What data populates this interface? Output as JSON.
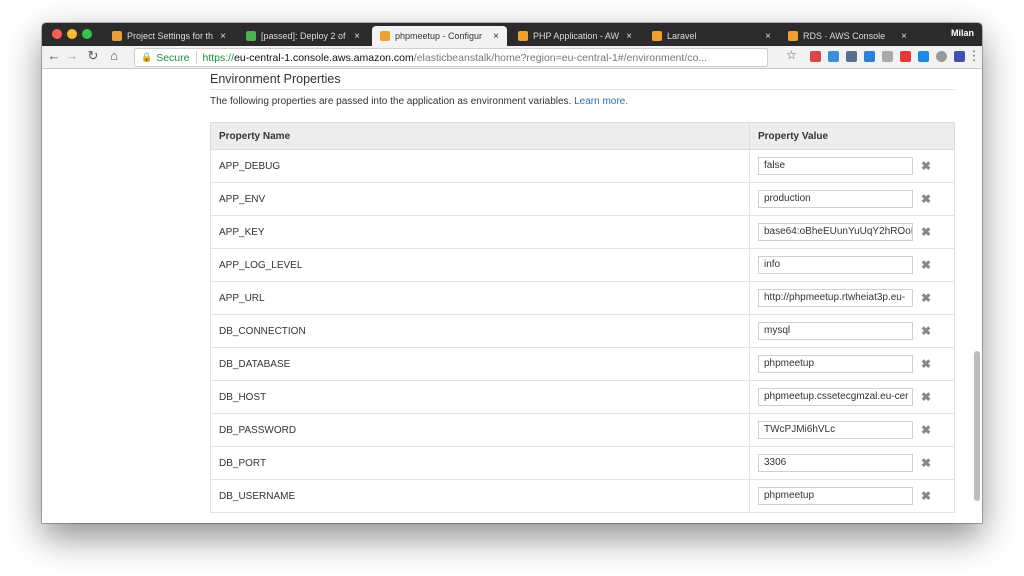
{
  "browser": {
    "tabs": [
      {
        "title": "Project Settings for th",
        "icon_color": "#e8a13a",
        "active": false
      },
      {
        "title": "[passed]: Deploy 2 of",
        "icon_color": "#4caf50",
        "active": false
      },
      {
        "title": "phpmeetup - Configur",
        "icon_color": "#f0a030",
        "active": true
      },
      {
        "title": "PHP Application - AW",
        "icon_color": "#f0a030",
        "active": false
      },
      {
        "title": "Laravel",
        "icon_color": "#f0a030",
        "active": false
      },
      {
        "title": "RDS · AWS Console",
        "icon_color": "#f0a030",
        "active": false
      }
    ],
    "profile_name": "Milan",
    "secure_label": "Secure",
    "url": {
      "scheme": "https://",
      "host": "eu-central-1.console.aws.amazon.com",
      "path": "/elasticbeanstalk/home?region=eu-central-1#/environment/co..."
    }
  },
  "section": {
    "title": "Environment Properties",
    "description": "The following properties are passed into the application as environment variables.",
    "learn_more": "Learn more."
  },
  "table": {
    "headers": {
      "name": "Property Name",
      "value": "Property Value"
    },
    "rows": [
      {
        "name": "APP_DEBUG",
        "value": "false"
      },
      {
        "name": "APP_ENV",
        "value": "production"
      },
      {
        "name": "APP_KEY",
        "value": "base64:oBheEUunYuUqY2hROoI"
      },
      {
        "name": "APP_LOG_LEVEL",
        "value": "info"
      },
      {
        "name": "APP_URL",
        "value": "http://phpmeetup.rtwheiat3p.eu-"
      },
      {
        "name": "DB_CONNECTION",
        "value": "mysql"
      },
      {
        "name": "DB_DATABASE",
        "value": "phpmeetup"
      },
      {
        "name": "DB_HOST",
        "value": "phpmeetup.cssetecgmzal.eu-cer"
      },
      {
        "name": "DB_PASSWORD",
        "value": "TWcPJMi6hVLc"
      },
      {
        "name": "DB_PORT",
        "value": "3306"
      },
      {
        "name": "DB_USERNAME",
        "value": "phpmeetup"
      }
    ],
    "delete_glyph": "✖"
  }
}
